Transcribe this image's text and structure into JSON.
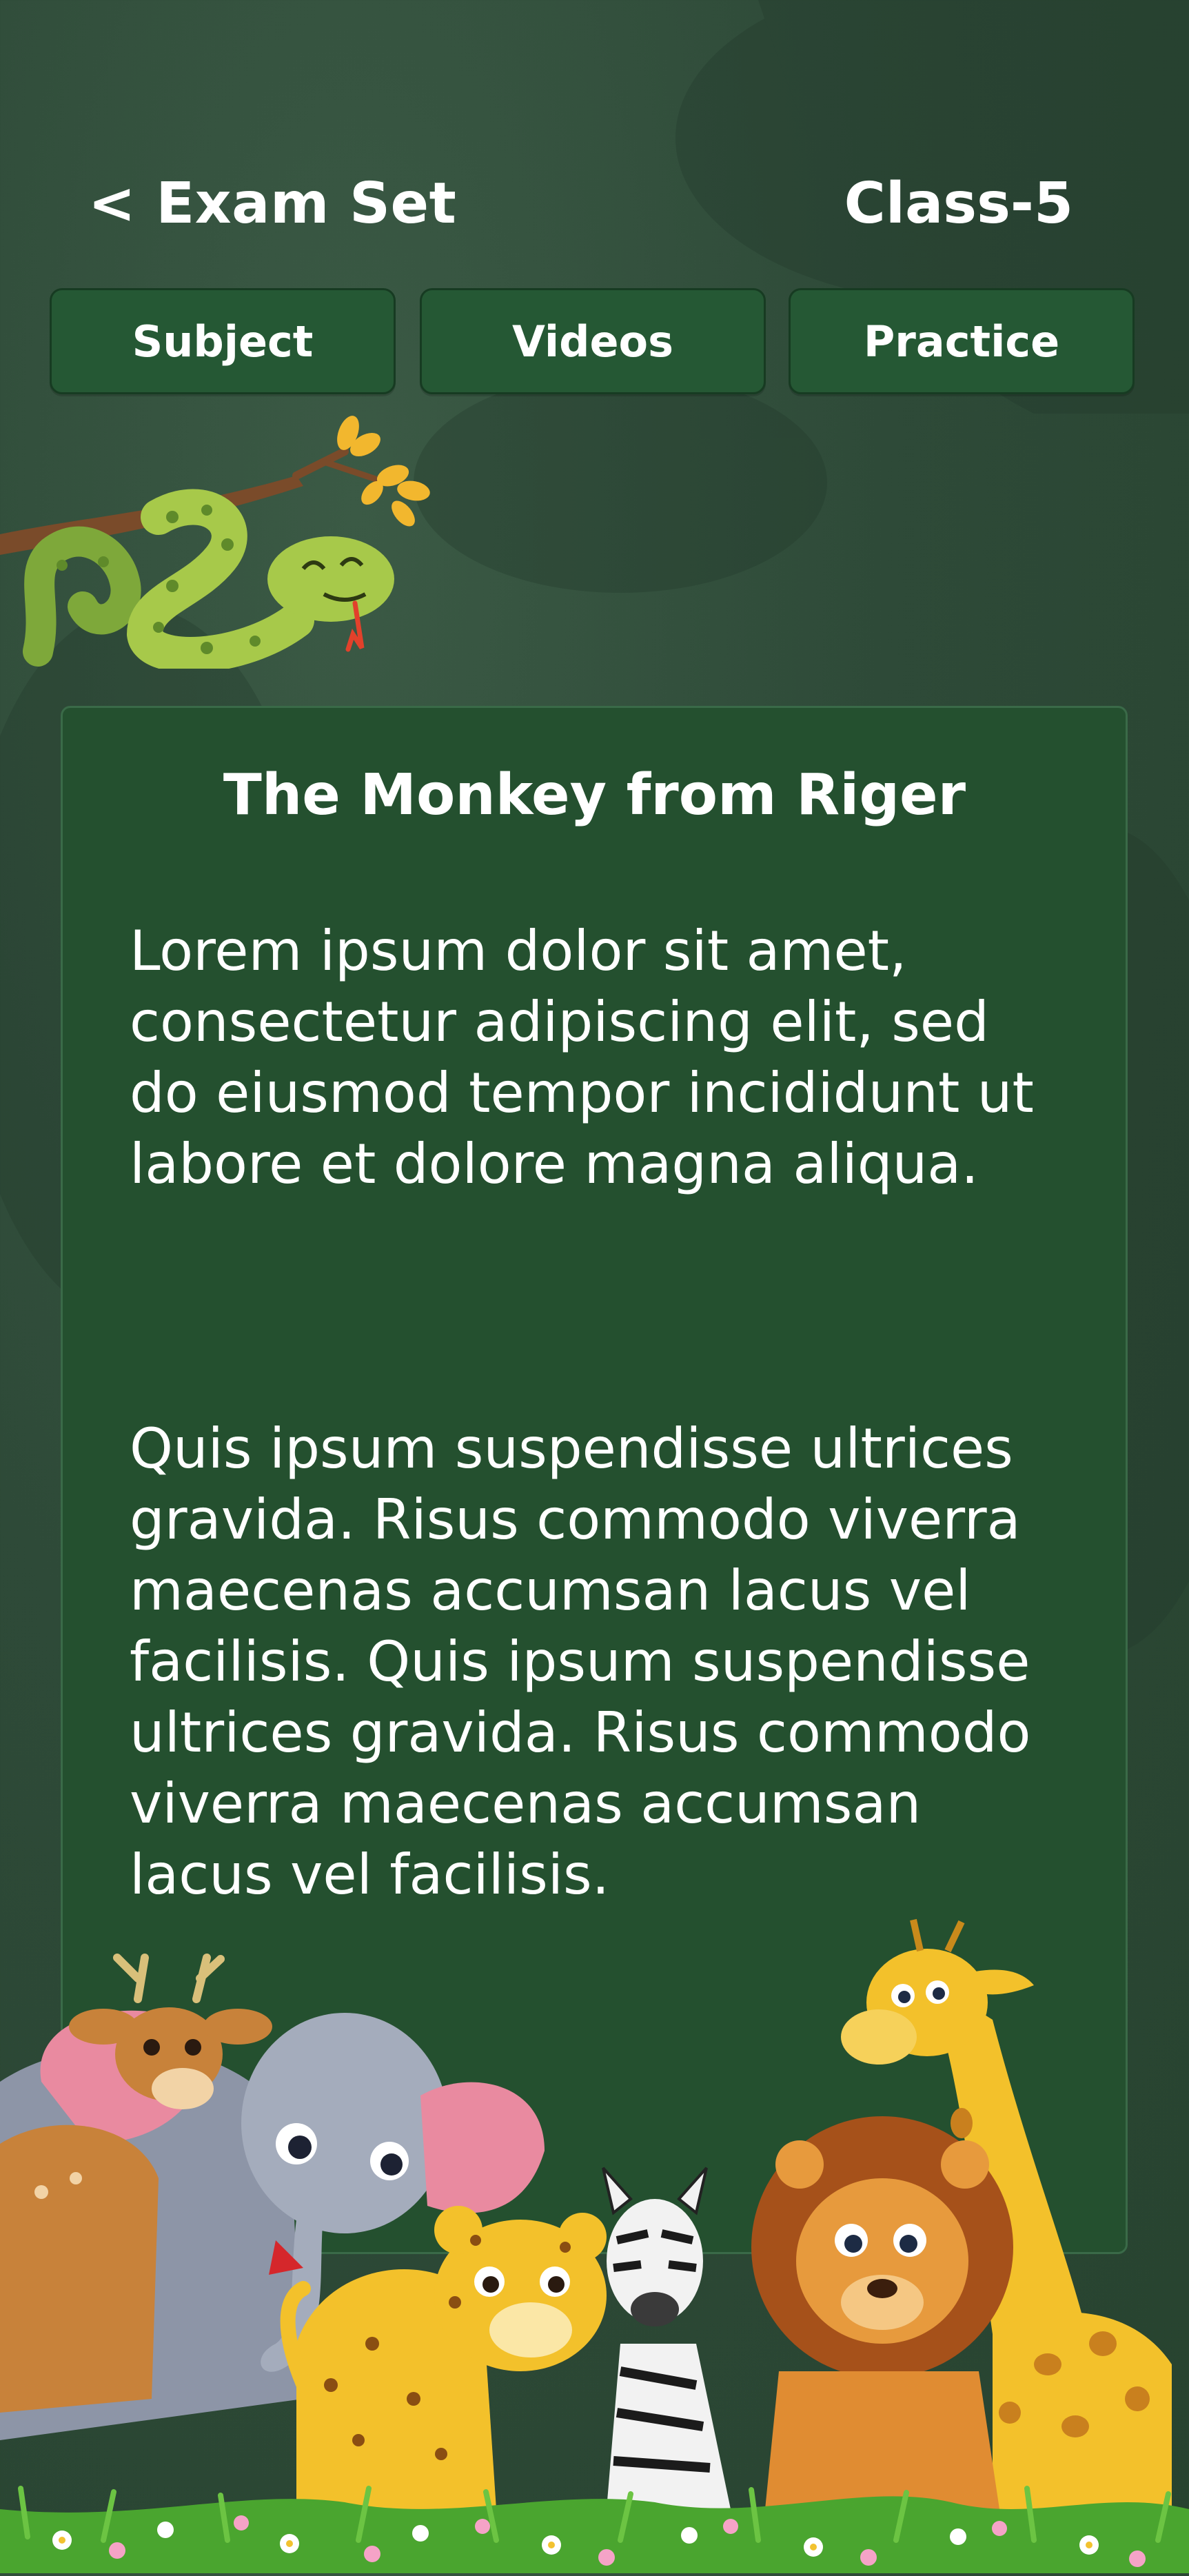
{
  "header": {
    "back_title": "< Exam Set",
    "class_label": "Class-5"
  },
  "tabs": [
    {
      "label": "Subject"
    },
    {
      "label": "Videos"
    },
    {
      "label": "Practice"
    }
  ],
  "story": {
    "title": "The Monkey from Riger",
    "paragraph_1": "Lorem ipsum dolor sit amet, consectetur adipiscing elit, sed do eiusmod tempor incididunt ut labore et dolore magna aliqua.",
    "paragraph_2": "Quis ipsum suspendisse ultrices gravida. Risus commodo viverra maecenas accumsan lacus vel facilisis. Quis ipsum suspendisse ultrices gravida. Risus commodo viverra maecenas accumsan lacus vel facilisis."
  },
  "illustrations": {
    "top": "snake-on-branch",
    "bottom": "jungle-animals-elephant-deer-leopard-zebra-lion-giraffe"
  },
  "colors": {
    "background": "#2e4a38",
    "card": "#24502f",
    "tab": "#255834",
    "text": "#ffffff"
  }
}
